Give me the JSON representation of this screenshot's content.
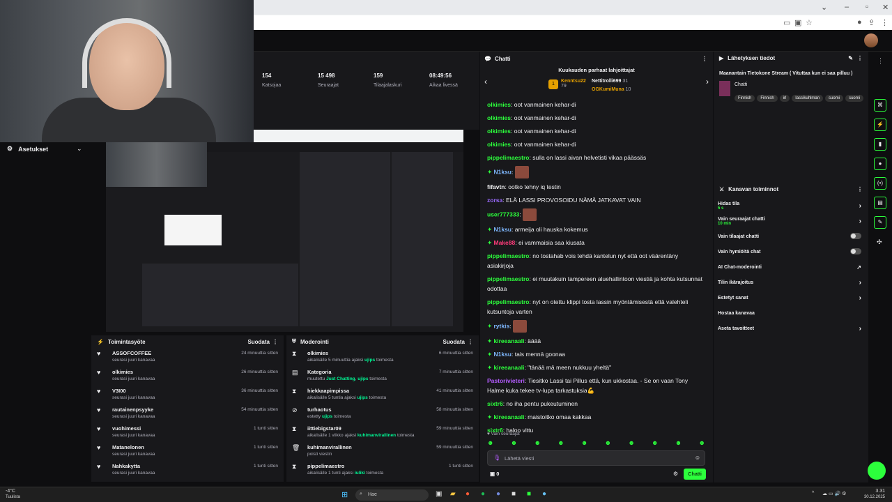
{
  "stats": [
    {
      "value": "154",
      "label": "Katsojaa"
    },
    {
      "value": "15 498",
      "label": "Seuraajat"
    },
    {
      "value": "159",
      "label": "Tilaajalaskuri"
    },
    {
      "value": "08:49:56",
      "label": "Aikaa livessä"
    }
  ],
  "settings": {
    "title": "Asetukset"
  },
  "activity": {
    "title": "Toimintasyöte",
    "filter": "Suodata",
    "items": [
      {
        "name": "ASSOFCOFFEE",
        "sub": "seurasi juuri kanavaa",
        "time": "24 minuuttia sitten"
      },
      {
        "name": "olkimies",
        "sub": "seurasi juuri kanavaa",
        "time": "26 minuuttia sitten"
      },
      {
        "name": "V3I00",
        "sub": "seurasi juuri kanavaa",
        "time": "36 minuuttia sitten"
      },
      {
        "name": "rautainenpsyyke",
        "sub": "seurasi juuri kanavaa",
        "time": "54 minuuttia sitten"
      },
      {
        "name": "vuohimessi",
        "sub": "seurasi juuri kanavaa",
        "time": "1 tunti sitten"
      },
      {
        "name": "Matanelonen",
        "sub": "seurasi juuri kanavaa",
        "time": "1 tunti sitten"
      },
      {
        "name": "Nahkakytta",
        "sub": "seurasi juuri kanavaa",
        "time": "1 tunti sitten"
      }
    ]
  },
  "moderation": {
    "title": "Moderointi",
    "filter": "Suodata",
    "items": [
      {
        "name": "olkimies",
        "pre": "aikalisälle 5 minuuttia ajaksi ",
        "who": "ujips",
        "post": " toimesta",
        "time": "6 minuuttia sitten"
      },
      {
        "name": "Kategoria",
        "pre": "muutettu ",
        "who": "Just Chatting",
        "mid": ", ",
        "who2": "ujips",
        "post": " toimesta",
        "time": "7 minuuttia sitten"
      },
      {
        "name": "hiekkaapimpissa",
        "pre": "aikalisälle 5 tuntia ajaksi ",
        "who": "ujips",
        "post": " toimesta",
        "time": "41 minuuttia sitten"
      },
      {
        "name": "turhaotus",
        "pre": "estetty ",
        "who": "ujips",
        "post": " toimesta",
        "time": "58 minuuttia sitten"
      },
      {
        "name": "iittiebigstar09",
        "pre": "aikalisälle 1 viikko ajaksi ",
        "who": "kuhimanvirallinen",
        "post": " toimesta",
        "time": "59 minuuttia sitten"
      },
      {
        "name": "kuhimanvirallinen",
        "pre": "poisti viestin",
        "who": "",
        "post": "",
        "time": "59 minuuttia sitten"
      },
      {
        "name": "pippelimaestro",
        "pre": "aikalisälle 1 tunti ajaksi ",
        "who": "iuliki",
        "post": " toimesta",
        "time": "1 tunti sitten"
      }
    ]
  },
  "chat": {
    "title": "Chatti",
    "top_gifters_title": "Kuukauden parhaat lahjoittajat",
    "gifters": [
      {
        "name": "Kenntsu22",
        "count": "79"
      },
      {
        "name": "Nettitrolli699",
        "count": "31"
      },
      {
        "name": "OGKumiMuna",
        "count": "10"
      }
    ],
    "messages": [
      {
        "user": "olkimies",
        "color": "#2cff3c",
        "text": "oot vanmainen kehar-di"
      },
      {
        "user": "olkimies",
        "color": "#2cff3c",
        "text": "oot vanmainen kehar-di"
      },
      {
        "user": "olkimies",
        "color": "#2cff3c",
        "text": "oot vanmainen kehar-di"
      },
      {
        "user": "olkimies",
        "color": "#2cff3c",
        "text": "oot vanmainen kehar-di"
      },
      {
        "user": "pippelimaestro",
        "color": "#2cff3c",
        "text": "sulla on lassi aivan helvetisti vikaa päässäs"
      },
      {
        "user": "N1ksu",
        "color": "#7fb8ff",
        "text": "",
        "emote": true
      },
      {
        "user": "fifavtn",
        "color": "#efeff1",
        "text": "ootko tehny iq testin"
      },
      {
        "user": "zorsa",
        "color": "#9b6bff",
        "text": "ELÄ LASSI PROVOSOIDU NÄMÄ JATKAVAT VAIN"
      },
      {
        "user": "user777333",
        "color": "#2cff3c",
        "text": "",
        "emote": true
      },
      {
        "user": "N1ksu",
        "color": "#7fb8ff",
        "text": "armeija oli hauska kokemus"
      },
      {
        "user": "Make88",
        "color": "#ff3b7a",
        "text": "ei vammaisia saa kiusata"
      },
      {
        "user": "pippelimaestro",
        "color": "#2cff3c",
        "text": "no tostahab vois tehdä kantelun nyt että oot väärentäny asiakirjoja"
      },
      {
        "user": "pippelimaestro",
        "color": "#2cff3c",
        "text": "ei muutakuin tampereen aluehallintoon viestiä ja kohta kutsunnat odottaa"
      },
      {
        "user": "pippelimaestro",
        "color": "#2cff3c",
        "text": "nyt on otettu klippi tosta lassin myöntämisestä että valehteli kutsuntoja varten"
      },
      {
        "user": "rytkis",
        "color": "#7fb8ff",
        "text": "",
        "emote": true
      },
      {
        "user": "kireeanaali",
        "color": "#2cff3c",
        "text": "ääää"
      },
      {
        "user": "N1ksu",
        "color": "#7fb8ff",
        "text": "tais mennä goonaa"
      },
      {
        "user": "kireeanaali",
        "color": "#2cff3c",
        "text": "\"tänää mä meen nukkuu yheltä\""
      },
      {
        "user": "Pastorivieteri",
        "color": "#b45cff",
        "text": "Tiesitko Lassi tai Pillus että, kun ukkostaa. - Se on vaan Tony Halme kuka tekee tv-lupa tarkastuksia💪"
      },
      {
        "user": "sixtr6",
        "color": "#2cff3c",
        "text": "no iha pentu pukeutuminen"
      },
      {
        "user": "kireeanaali",
        "color": "#2cff3c",
        "text": "maistoitko omaa kakkaa"
      },
      {
        "user": "sixtr6",
        "color": "#2cff3c",
        "text": "haloo vittu"
      }
    ],
    "followers_only": "Vain seuraajat",
    "input_placeholder": "Lähetä viesti",
    "points": "0",
    "send_label": "Chatti"
  },
  "broadcast": {
    "title": "Lähetyksen tiedot",
    "stream_title": "Maanantain Tietokone Stream ( Vituttaa kun ei saa pilluu )",
    "category": "Chatti",
    "tags": [
      "Finnish",
      "Finnish",
      "irl",
      "lassikuhlman",
      "suomi",
      "suomi"
    ]
  },
  "mod_actions": {
    "title": "Kanavan toiminnot",
    "items": [
      {
        "label": "Hidas tila",
        "sub": "5 s",
        "type": "chevron"
      },
      {
        "label": "Vain seuraajat chatti",
        "sub": "10 min",
        "type": "chevron"
      },
      {
        "label": "Vain tilaajat chatti",
        "sub": "",
        "type": "toggle"
      },
      {
        "label": "Vain hymiöitä chat",
        "sub": "",
        "type": "toggle"
      },
      {
        "label": "AI Chat-moderointi",
        "sub": "",
        "type": "external"
      },
      {
        "label": "Tilin ikärajoitus",
        "sub": "",
        "type": "chevron"
      },
      {
        "label": "Estetyt sanat",
        "sub": "",
        "type": "chevron"
      },
      {
        "label": "Hostaa kanavaa",
        "sub": "",
        "type": "none"
      },
      {
        "label": "Aseta tavoitteet",
        "sub": "",
        "type": "chevron"
      }
    ]
  },
  "taskbar": {
    "weather": "-4°C",
    "weather_sub": "Tuulista",
    "search": "Hae",
    "time": "3.31",
    "date": "30.12.2025"
  }
}
